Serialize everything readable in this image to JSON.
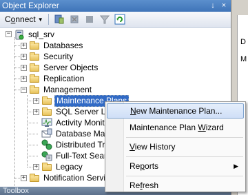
{
  "window": {
    "title": "Object Explorer",
    "pin_glyph": "↓",
    "close_glyph": "×"
  },
  "toolbar": {
    "connect_label_prefix": "C",
    "connect_label_underlined": "o",
    "connect_label_rest": "nnect",
    "dropdown_glyph": "▼"
  },
  "tree": {
    "root": {
      "label": "sql_srv",
      "expander": "−"
    },
    "items": [
      {
        "label": "Databases",
        "expander": "+"
      },
      {
        "label": "Security",
        "expander": "+"
      },
      {
        "label": "Server Objects",
        "expander": "+"
      },
      {
        "label": "Replication",
        "expander": "+"
      },
      {
        "label": "Management",
        "expander": "−"
      }
    ],
    "management_children": [
      {
        "label": "Maintenance Plans",
        "expander": "+"
      },
      {
        "label": "SQL Server Lo",
        "expander": "+"
      },
      {
        "label": "Activity Monito"
      },
      {
        "label": "Database Mail"
      },
      {
        "label": "Distributed Tra"
      },
      {
        "label": "Full-Text Searc"
      },
      {
        "label": "Legacy",
        "expander": "+"
      }
    ],
    "after": [
      {
        "label": "Notification Service",
        "expander": "+"
      }
    ]
  },
  "context_menu": {
    "items": [
      {
        "label": "New Maintenance Plan...",
        "u": "N",
        "rest": "ew Maintenance Plan..."
      },
      {
        "label": "Maintenance Plan Wizard",
        "before": "Maintenance Plan ",
        "u": "W",
        "rest": "izard"
      },
      {
        "label": "View History",
        "u": "V",
        "rest": "iew History"
      },
      {
        "label": "Reports",
        "before": "Re",
        "u": "p",
        "rest": "orts",
        "submenu_glyph": "▶"
      },
      {
        "label": "Refresh",
        "before": "Re",
        "u": "f",
        "rest": "resh"
      }
    ]
  },
  "bottom": {
    "toolbox_label": "Toolbox"
  },
  "right_panel": {
    "letters": [
      "D",
      "M"
    ]
  }
}
